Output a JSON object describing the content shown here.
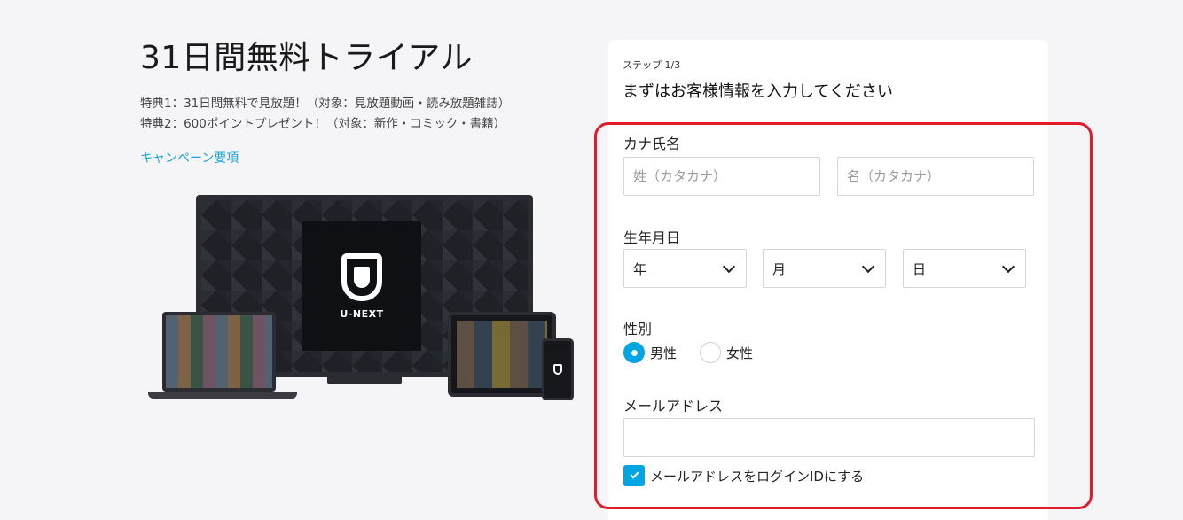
{
  "left": {
    "title": "31日間無料トライアル",
    "perks": [
      "特典1：31日間無料で見放題！（対象：見放題動画・読み放題雑誌）",
      "特典2：600ポイントプレゼント！（対象：新作・コミック・書籍）"
    ],
    "campaign_link": "キャンペーン要項",
    "logo_text": "U-NEXT"
  },
  "form": {
    "step": "ステップ 1/3",
    "heading": "まずはお客様情報を入力してください",
    "kana_name": {
      "label": "カナ氏名",
      "last_placeholder": "姓（カタカナ）",
      "first_placeholder": "名（カタカナ）"
    },
    "birthdate": {
      "label": "生年月日",
      "year": "年",
      "month": "月",
      "day": "日"
    },
    "gender": {
      "label": "性別",
      "male": "男性",
      "female": "女性",
      "selected": "男性"
    },
    "email": {
      "label": "メールアドレス",
      "value": "",
      "use_as_login_label": "メールアドレスをログインIDにする",
      "use_as_login_checked": true
    }
  },
  "colors": {
    "accent": "#00a5e3",
    "link": "#1aa3d9",
    "highlight": "#e01c2a"
  }
}
